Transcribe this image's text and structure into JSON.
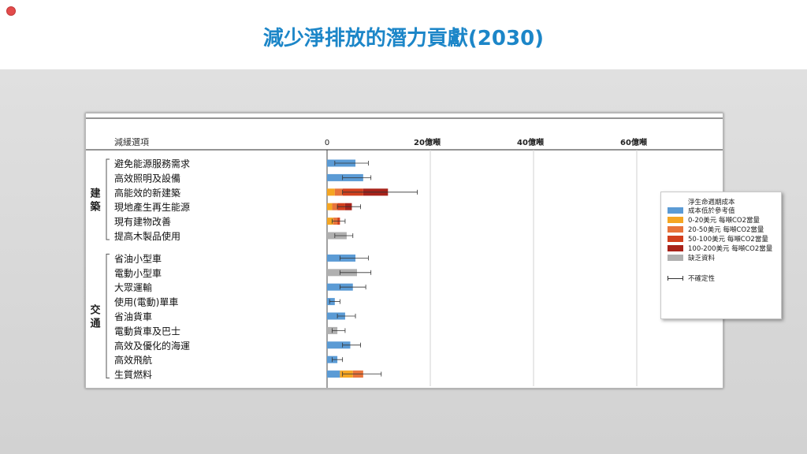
{
  "title": "減少淨排放的潛力貢獻(2030)",
  "chart_data": {
    "type": "bar",
    "stacked": true,
    "orientation": "horizontal",
    "column_header": "減緩選項",
    "xticks": [
      "0",
      "20億噸",
      "40億噸",
      "60億噸"
    ],
    "xlim": [
      0,
      60
    ],
    "groups": [
      {
        "name": "建築",
        "start": 0,
        "end": 5
      },
      {
        "name": "交通",
        "start": 6,
        "end": 14
      }
    ],
    "categories": [
      "避免能源服務需求",
      "高效照明及設備",
      "高能效的新建築",
      "現地產生再生能源",
      "現有建物改善",
      "提高木製品使用",
      "省油小型車",
      "電動小型車",
      "大眾運輸",
      "使用(電動)單車",
      "省油貨車",
      "電動貨車及巴士",
      "高效及優化的海運",
      "高效飛航",
      "生質燃料"
    ],
    "colors": {
      "below": "#5b9bd5",
      "c0_20": "#f5a623",
      "c20_50": "#e8743b",
      "c50_100": "#d2401e",
      "c100_200": "#a8231a",
      "nodata": "#b0b0b0"
    },
    "series": [
      {
        "name": "成本低於參考值",
        "key": "below",
        "values": [
          5.5,
          7.0,
          0,
          0,
          0,
          0,
          5.5,
          0,
          5.0,
          1.5,
          3.5,
          0,
          4.5,
          2.0,
          2.5
        ]
      },
      {
        "name": "0-20美元 每噸CO2當量",
        "key": "c0_20",
        "values": [
          0,
          0,
          1.5,
          1.0,
          1.2,
          0,
          0,
          0,
          0,
          0,
          0,
          0,
          0,
          0,
          2.5
        ]
      },
      {
        "name": "20-50美元 每噸CO2當量",
        "key": "c20_50",
        "values": [
          0,
          0,
          1.5,
          1.0,
          0.8,
          0,
          0,
          0,
          0,
          0,
          0,
          0,
          0,
          0,
          2.0
        ]
      },
      {
        "name": "50-100美元 每噸CO2當量",
        "key": "c50_100",
        "values": [
          0,
          0,
          4.0,
          1.5,
          0.5,
          0,
          0,
          0,
          0,
          0,
          0,
          0,
          0,
          0,
          0
        ]
      },
      {
        "name": "100-200美元 每噸CO2當量",
        "key": "c100_200",
        "values": [
          0,
          0,
          4.8,
          1.3,
          0,
          0,
          0,
          0,
          0,
          0,
          0,
          0,
          0,
          0,
          0
        ]
      },
      {
        "name": "缺乏資料",
        "key": "nodata",
        "values": [
          0,
          0,
          0,
          0,
          0,
          3.8,
          0,
          5.8,
          0,
          0,
          0,
          2.0,
          0,
          0,
          0
        ]
      }
    ],
    "error_bars": [
      [
        1.5,
        8.0
      ],
      [
        3.0,
        8.5
      ],
      [
        3.0,
        17.5
      ],
      [
        2.0,
        6.5
      ],
      [
        1.0,
        3.5
      ],
      [
        1.5,
        5.0
      ],
      [
        2.5,
        8.0
      ],
      [
        2.5,
        8.5
      ],
      [
        2.5,
        7.5
      ],
      [
        0.5,
        2.5
      ],
      [
        2.0,
        5.5
      ],
      [
        1.0,
        3.5
      ],
      [
        3.0,
        6.5
      ],
      [
        1.0,
        3.0
      ],
      [
        3.0,
        10.5
      ]
    ],
    "legend": {
      "title_lines": [
        "淨生命週期成本"
      ],
      "error_label": "不確定性",
      "position": "right"
    },
    "grid": true
  }
}
